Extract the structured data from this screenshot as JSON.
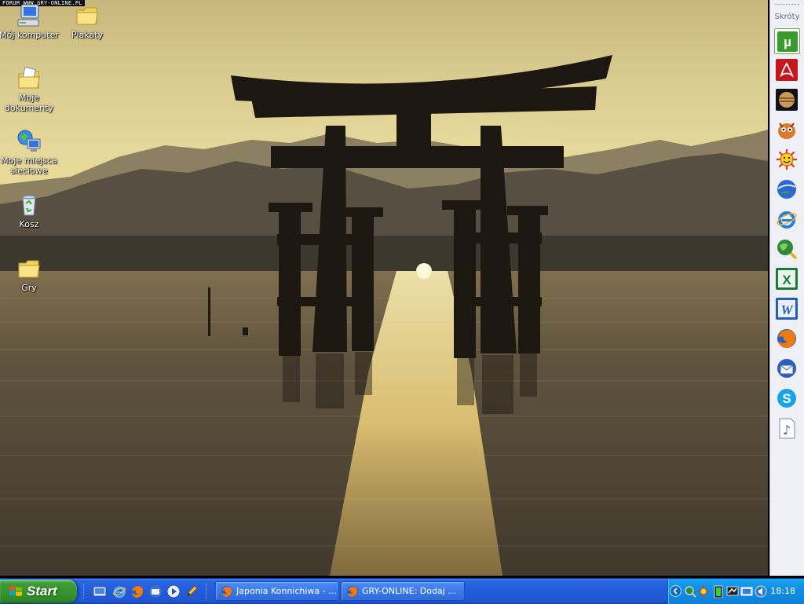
{
  "watermark": "FORUM WWW.GRY-ONLINE.PL",
  "desktop": {
    "icons": [
      {
        "label": "Mój komputer",
        "icon": "my-computer-icon"
      },
      {
        "label": "Plakaty",
        "icon": "folder-icon"
      },
      {
        "label": "Moje dokumenty",
        "icon": "my-documents-icon"
      },
      {
        "label": "Moje miejsca sieciowe",
        "icon": "network-places-icon"
      },
      {
        "label": "Kosz",
        "icon": "recycle-bin-icon"
      },
      {
        "label": "Gry",
        "icon": "folder-icon"
      }
    ]
  },
  "dock": {
    "title": "Skróty",
    "items": [
      {
        "name": "utorrent",
        "icon": "utorrent-icon",
        "glyph": "µ"
      },
      {
        "name": "acrobat",
        "icon": "acrobat-icon"
      },
      {
        "name": "celestia",
        "icon": "planets-icon"
      },
      {
        "name": "gadu-gadu",
        "icon": "messenger-animal-icon"
      },
      {
        "name": "sun-app",
        "icon": "smiling-sun-icon"
      },
      {
        "name": "google-earth",
        "icon": "google-earth-icon"
      },
      {
        "name": "internet-explorer",
        "icon": "internet-explorer-icon"
      },
      {
        "name": "globe-search",
        "icon": "globe-magnifier-icon"
      },
      {
        "name": "excel",
        "icon": "excel-icon",
        "glyph": "X"
      },
      {
        "name": "word",
        "icon": "word-icon",
        "glyph": "W"
      },
      {
        "name": "firefox",
        "icon": "firefox-icon"
      },
      {
        "name": "thunderbird",
        "icon": "thunderbird-icon"
      },
      {
        "name": "skype",
        "icon": "skype-icon",
        "glyph": "S"
      },
      {
        "name": "music",
        "icon": "music-note-icon",
        "glyph": "♪"
      }
    ]
  },
  "taskbar": {
    "start_label": "Start",
    "quick_launch": [
      "show-desktop-icon",
      "internet-explorer-icon",
      "firefox-icon",
      "thunderbird-icon",
      "media-player-icon",
      "pencil-icon"
    ],
    "tasks": [
      {
        "label": "Japonia Konnichiwa - ...",
        "icon": "firefox-icon"
      },
      {
        "label": "GRY-ONLINE: Dodaj ...",
        "icon": "firefox-icon"
      }
    ],
    "tray_icons": [
      "search-tray-icon",
      "sun-tray-icon",
      "battery-tray-icon",
      "network-tray-icon",
      "monitor-tray-icon",
      "volume-tray-icon"
    ],
    "clock": "18:18"
  },
  "colors": {
    "sky": "#e6d89a",
    "water": "#4f4636",
    "dock_bg": "#eef0f6",
    "taskbar": "#245ddb",
    "start_green": "#36932d",
    "tray": "#128ee4"
  }
}
